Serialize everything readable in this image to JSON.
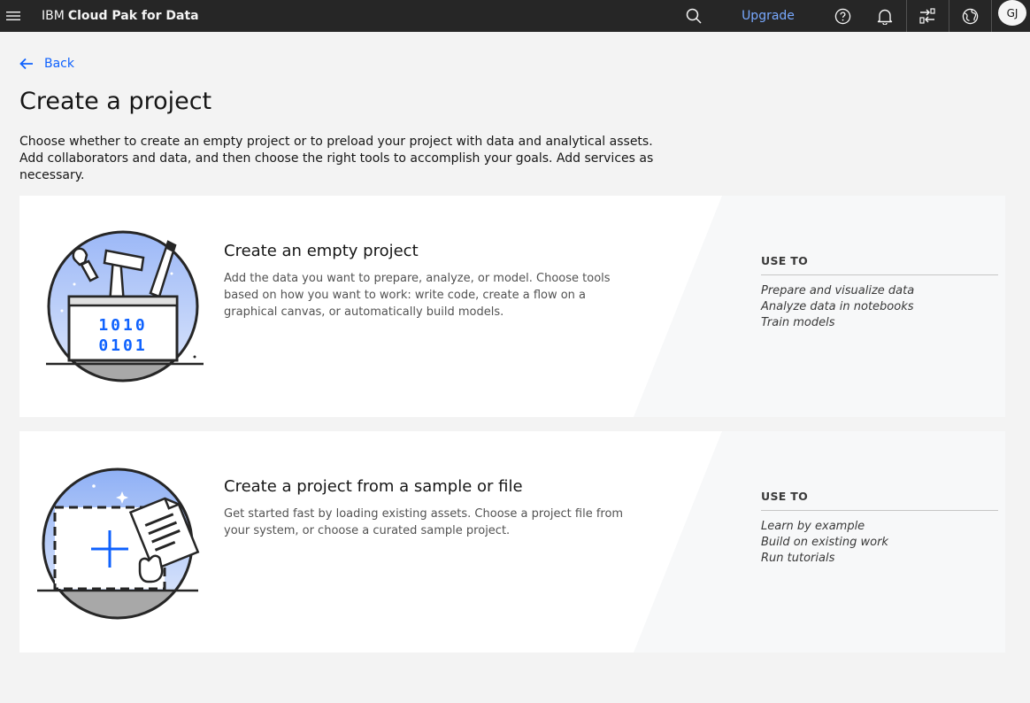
{
  "header": {
    "brand_plain": "IBM",
    "brand_bold": "Cloud Pak for Data",
    "upgrade_label": "Upgrade",
    "avatar_initials": "GJ",
    "icons": [
      "menu-icon",
      "search-icon",
      "help-icon",
      "notification-icon",
      "switcher-icon",
      "globe-icon"
    ]
  },
  "page": {
    "back_label": "Back",
    "title": "Create a project",
    "intro": "Choose whether to create an empty project or to preload your project with data and analytical assets. Add collaborators and data, and then choose the right tools to accomplish your goals. Add services as necessary."
  },
  "cards": [
    {
      "title": "Create an empty project",
      "description": "Add the data you want to prepare, analyze, or model. Choose tools based on how you want to work: write code, create a flow on a graphical canvas, or automatically build models.",
      "use_to_label": "USE TO",
      "uses": [
        "Prepare and visualize data",
        "Analyze data in notebooks",
        "Train models"
      ],
      "illustration_text": [
        "1010",
        "0101"
      ]
    },
    {
      "title": "Create a project from a sample or file",
      "description": "Get started fast by loading existing assets. Choose a project file from your system, or choose a curated sample project.",
      "use_to_label": "USE TO",
      "uses": [
        "Learn by example",
        "Build on existing work",
        "Run tutorials"
      ]
    }
  ],
  "colors": {
    "header_bg": "#262626",
    "accent_blue": "#0f62fe",
    "upgrade_link": "#78a9ff",
    "page_bg": "#f3f3f3",
    "card_bg": "#ffffff",
    "card_side_bg": "#f7f8f9"
  }
}
